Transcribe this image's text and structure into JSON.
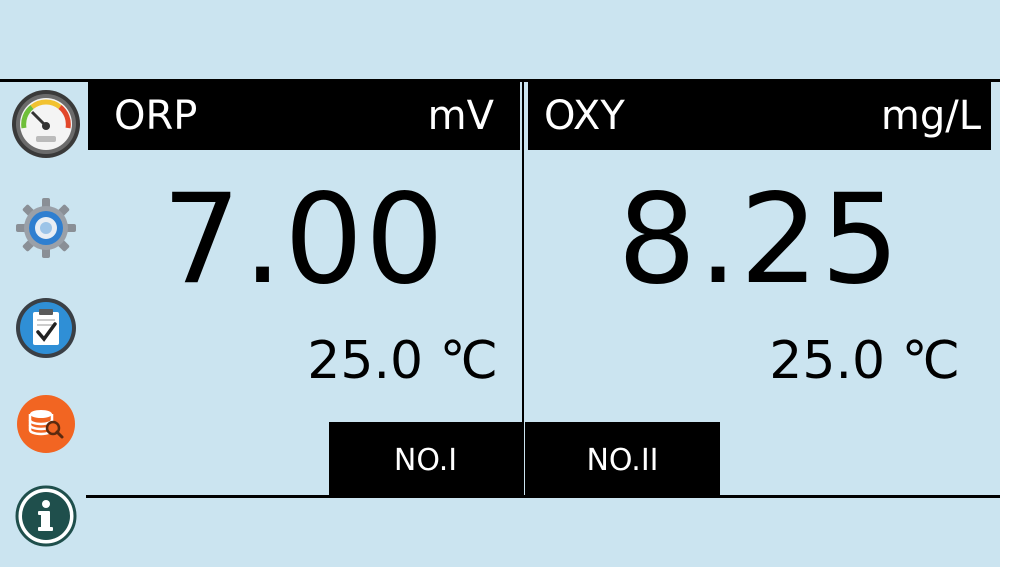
{
  "sidebar": {
    "items": [
      {
        "icon": "gauge-icon"
      },
      {
        "icon": "gear-icon"
      },
      {
        "icon": "clipboard-check-icon"
      },
      {
        "icon": "database-search-icon"
      },
      {
        "icon": "info-icon"
      }
    ]
  },
  "channels": [
    {
      "parameter": "ORP",
      "unit": "mV",
      "value": "7.00",
      "temperature": "25.0 ℃",
      "tab_label": "NO.I"
    },
    {
      "parameter": "OXY",
      "unit": "mg/L",
      "value": "8.25",
      "temperature": "25.0 ℃",
      "tab_label": "NO.II"
    }
  ],
  "colors": {
    "screen_background": "#cbe4f0",
    "header_background": "#000000",
    "header_text": "#ffffff",
    "database_icon": "#f26522",
    "info_icon": "#1f4f4c"
  }
}
